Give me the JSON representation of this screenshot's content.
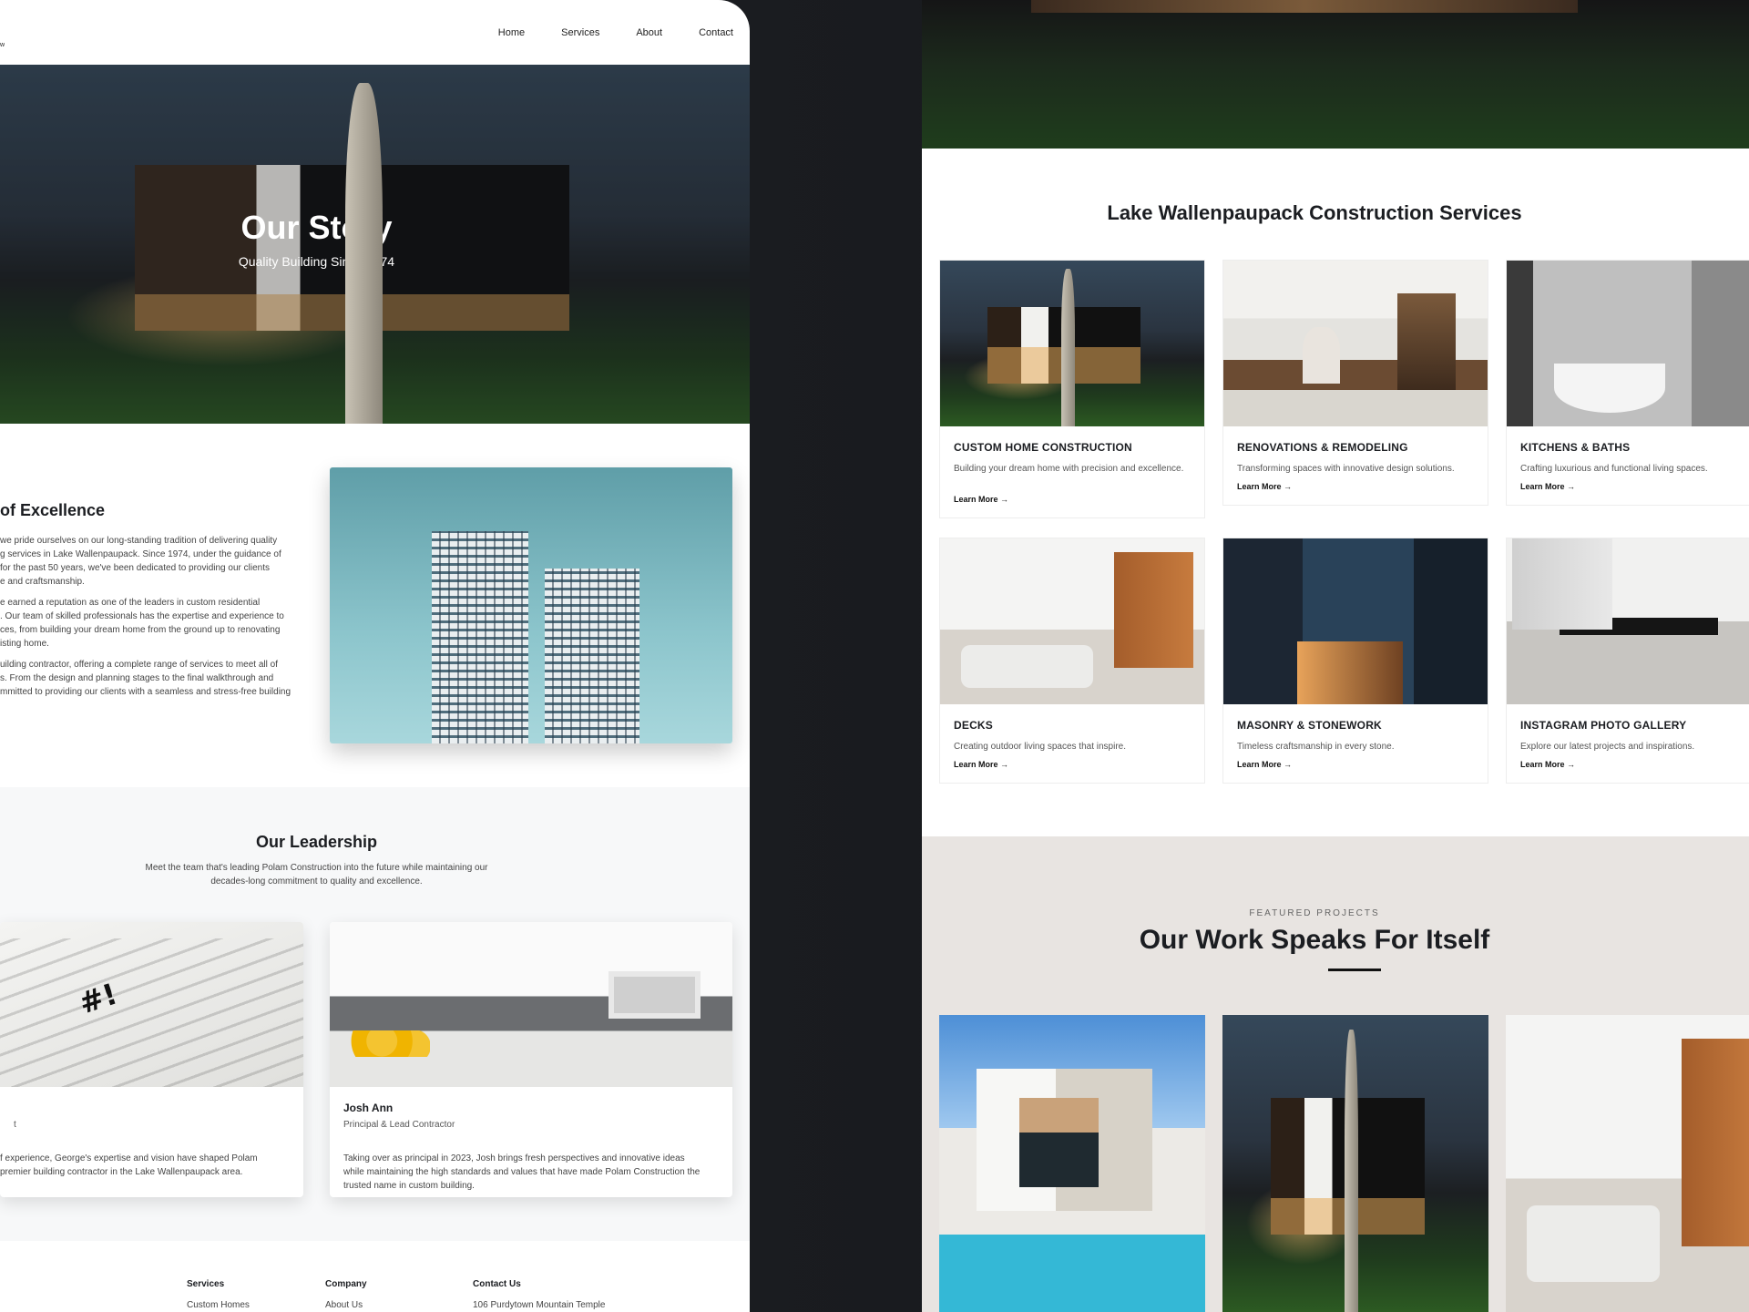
{
  "left": {
    "logo_fragment": "w",
    "nav": [
      "Home",
      "Services",
      "About",
      "Contact"
    ],
    "hero": {
      "title": "Our Story",
      "subtitle": "Quality Building Since 1974"
    },
    "excellence": {
      "heading": "of Excellence",
      "paragraphs": [
        [
          "we pride ourselves on our long-standing tradition of delivering quality",
          "g services in Lake Wallenpaupack. Since 1974, under the guidance of",
          " for the past 50 years, we've been dedicated to providing our clients",
          "e and craftsmanship."
        ],
        [
          "e earned a reputation as one of the leaders in custom residential",
          ". Our team of skilled professionals has the expertise and experience to",
          "ces, from building your dream home from the ground up to renovating",
          "isting home."
        ],
        [
          "uilding contractor, offering a complete range of services to meet all of",
          "s. From the design and planning stages to the final walkthrough and",
          "mmitted to providing our clients with a seamless and stress-free building"
        ]
      ]
    },
    "leadership": {
      "title": "Our Leadership",
      "subtitle_lines": [
        "Meet the team that's leading Polam Construction into the future while maintaining our",
        "decades-long commitment to quality and excellence."
      ],
      "cards": [
        {
          "name": "",
          "role": "t",
          "bio": [
            "f experience, George's expertise and vision have shaped Polam",
            " premier building contractor in the Lake Wallenpaupack area."
          ]
        },
        {
          "name": "Josh Ann",
          "role": "Principal & Lead Contractor",
          "bio": [
            "Taking over as principal in 2023, Josh brings fresh perspectives and innovative ideas",
            "while maintaining the high standards and values that have made Polam Construction the",
            "trusted name in custom building."
          ]
        }
      ]
    },
    "footer": [
      {
        "heading": "Services",
        "first_item": "Custom Homes"
      },
      {
        "heading": "Company",
        "first_item": "About Us"
      },
      {
        "heading": "Contact Us",
        "first_item": "106 Purdytown Mountain Temple"
      }
    ]
  },
  "right": {
    "services_title": "Lake Wallenpaupack Construction Services",
    "learn_more": "Learn More",
    "services": [
      {
        "title": "CUSTOM HOME CONSTRUCTION",
        "desc": "Building your dream home with precision and excellence.",
        "image": "modern-house"
      },
      {
        "title": "RENOVATIONS & REMODELING",
        "desc": "Transforming spaces with innovative design solutions.",
        "image": "kitchen"
      },
      {
        "title": "KITCHENS & BATHS",
        "desc": "Crafting luxurious and functional living spaces.",
        "image": "bathroom"
      },
      {
        "title": "DECKS",
        "desc": "Creating outdoor living spaces that inspire.",
        "image": "living-room"
      },
      {
        "title": "MASONRY & STONEWORK",
        "desc": "Timeless craftsmanship in every stone.",
        "image": "facade"
      },
      {
        "title": "INSTAGRAM PHOTO GALLERY",
        "desc": "Explore our latest projects and inspirations.",
        "image": "dining-room"
      }
    ],
    "featured": {
      "kicker": "FEATURED PROJECTS",
      "title": "Our Work Speaks For Itself"
    }
  },
  "colors": {
    "accent": "#111111",
    "featured_bg": "#e8e4e1",
    "leadership_bg": "#f7f8f9"
  }
}
